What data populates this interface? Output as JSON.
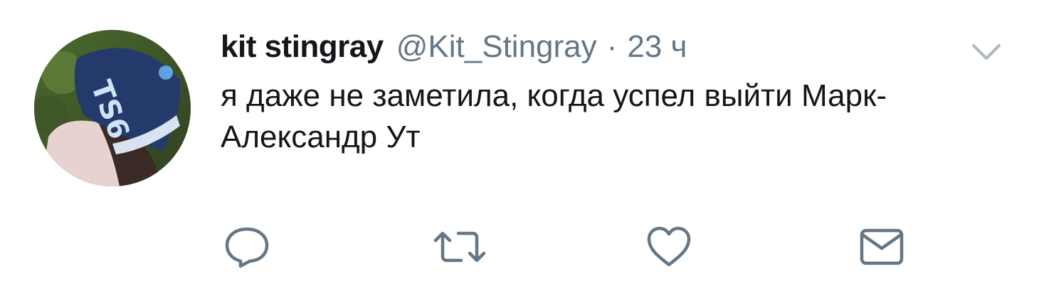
{
  "tweet": {
    "author_name": "kit stingray",
    "handle": "@Kit_Stingray",
    "separator": "·",
    "time": "23 ч",
    "text_line1": "я даже не заметила, когда успел выйти Марк-",
    "text_line2": "Александр Ут"
  },
  "icons": {
    "avatar": "avatar-photo",
    "menu": "chevron-down-icon",
    "reply": "reply-icon",
    "retweet": "retweet-icon",
    "like": "heart-icon",
    "dm": "envelope-icon"
  },
  "colors": {
    "text_primary": "#14171a",
    "text_secondary": "#657786",
    "icon": "#657786"
  }
}
